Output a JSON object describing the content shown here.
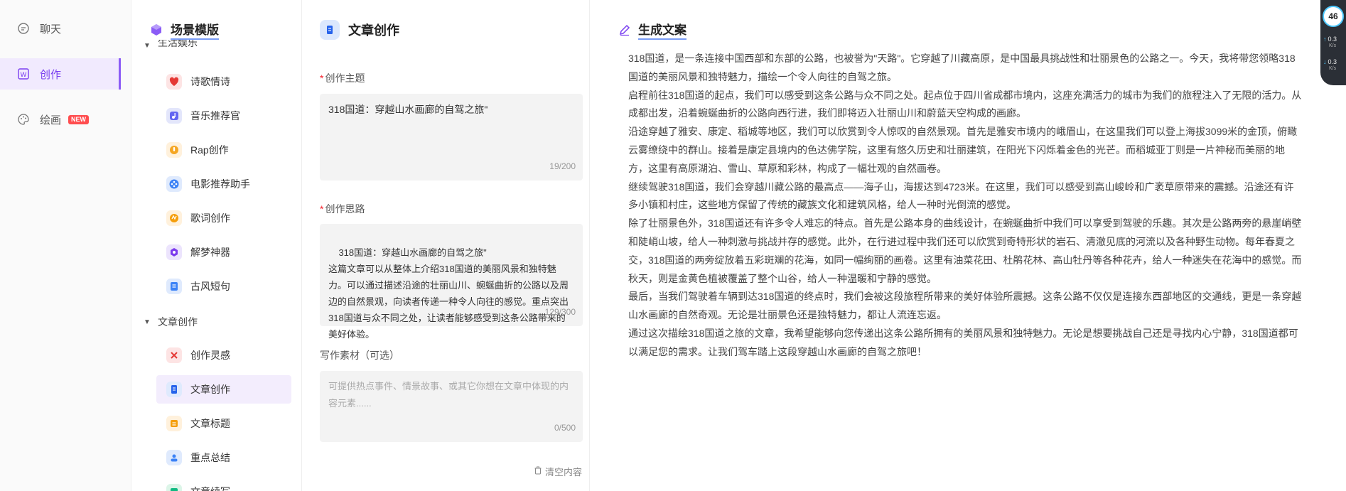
{
  "nav": {
    "items": [
      {
        "label": "聊天",
        "icon": "chat-bubble-icon"
      },
      {
        "label": "创作",
        "icon": "write-doc-icon"
      },
      {
        "label": "绘画",
        "icon": "palette-icon",
        "badge": "NEW"
      }
    ]
  },
  "scene": {
    "title": "场景模版",
    "group1": "生活娱乐",
    "group1_items": [
      "诗歌情诗",
      "音乐推荐官",
      "Rap创作",
      "电影推荐助手",
      "歌词创作",
      "解梦神器",
      "古风短句"
    ],
    "group2": "文章创作",
    "group2_items": [
      "创作灵感",
      "文章创作",
      "文章标题",
      "重点总结",
      "文章续写"
    ]
  },
  "form": {
    "title": "文章创作",
    "topic_label": "创作主题",
    "topic_value": "318国道：穿越山水画廊的自驾之旅\"",
    "topic_counter": "19/200",
    "idea_label": "创作思路",
    "idea_value": "318国道：穿越山水画廊的自驾之旅\"\n这篇文章可以从整体上介绍318国道的美丽风景和独特魅力。可以通过描述沿途的壮丽山川、蜿蜒曲折的公路以及周边的自然景观，向读者传递一种令人向往的感觉。重点突出318国道与众不同之处，让读者能够感受到这条公路带来的美好体验。",
    "idea_counter": "129/300",
    "material_label": "写作素材（可选）",
    "material_placeholder": "可提供热点事件、情景故事、或其它你想在文章中体现的内容元素......",
    "material_counter": "0/500",
    "clear_label": "清空内容"
  },
  "output": {
    "title": "生成文案",
    "paragraphs": [
      "318国道，是一条连接中国西部和东部的公路，也被誉为\"天路\"。它穿越了川藏高原，是中国最具挑战性和壮丽景色的公路之一。今天，我将带您领略318国道的美丽风景和独特魅力，描绘一个令人向往的自驾之旅。",
      "启程前往318国道的起点，我们可以感受到这条公路与众不同之处。起点位于四川省成都市境内，这座充满活力的城市为我们的旅程注入了无限的活力。从成都出发，沿着蜿蜒曲折的公路向西行进，我们即将迈入壮丽山川和蔚蓝天空构成的画廊。",
      "沿途穿越了雅安、康定、稻城等地区，我们可以欣赏到令人惊叹的自然景观。首先是雅安市境内的峨眉山，在这里我们可以登上海拔3099米的金顶，俯瞰云雾缭绕中的群山。接着是康定县境内的色达佛学院，这里有悠久历史和壮丽建筑，在阳光下闪烁着金色的光芒。而稻城亚丁则是一片神秘而美丽的地方，这里有高原湖泊、雪山、草原和彩林，构成了一幅壮观的自然画卷。",
      "继续驾驶318国道，我们会穿越川藏公路的最高点——海子山，海拔达到4723米。在这里，我们可以感受到高山峻岭和广袤草原带来的震撼。沿途还有许多小镇和村庄，这些地方保留了传统的藏族文化和建筑风格，给人一种时光倒流的感觉。",
      "除了壮丽景色外，318国道还有许多令人难忘的特点。首先是公路本身的曲线设计，在蜿蜒曲折中我们可以享受到驾驶的乐趣。其次是公路两旁的悬崖峭壁和陡峭山坡，给人一种刺激与挑战并存的感觉。此外，在行进过程中我们还可以欣赏到奇特形状的岩石、清澈见底的河流以及各种野生动物。每年春夏之交，318国道的两旁绽放着五彩斑斓的花海，如同一幅绚丽的画卷。这里有油菜花田、杜鹃花林、高山牡丹等各种花卉，给人一种迷失在花海中的感觉。而秋天，则是金黄色植被覆盖了整个山谷，给人一种温暖和宁静的感觉。",
      "最后，当我们驾驶着车辆到达318国道的终点时，我们会被这段旅程所带来的美好体验所震撼。这条公路不仅仅是连接东西部地区的交通线，更是一条穿越山水画廊的自然奇观。无论是壮丽景色还是独特魅力，都让人流连忘返。",
      "通过这次描绘318国道之旅的文章，我希望能够向您传递出这条公路所拥有的美丽风景和独特魅力。无论是想要挑战自己还是寻找内心宁静，318国道都可以满足您的需求。让我们驾车踏上这段穿越山水画廊的自驾之旅吧！"
    ]
  },
  "widget": {
    "percent": "46",
    "up_rate": "0.3",
    "down_rate": "0.3",
    "unit": "K/s"
  }
}
